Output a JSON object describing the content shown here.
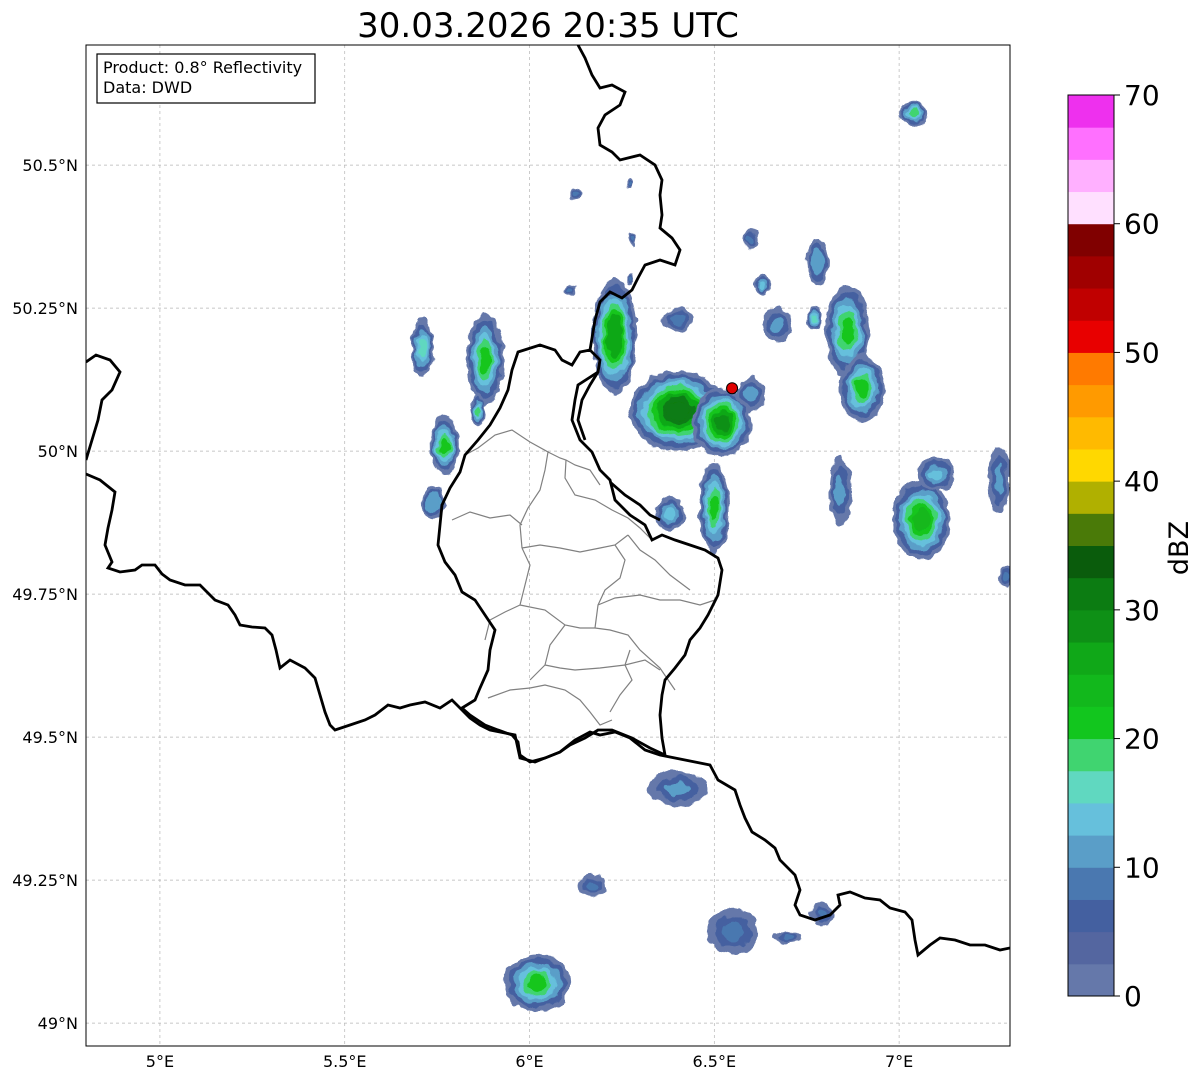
{
  "title": "30.03.2026 20:35 UTC",
  "info_box": {
    "product": "Product: 0.8° Reflectivity",
    "data_source": "Data: DWD"
  },
  "map": {
    "lon_range": [
      4.8,
      7.3
    ],
    "lat_range": [
      48.96,
      50.71
    ],
    "lon_ticks": [
      {
        "value": 5.0,
        "label": "5°E"
      },
      {
        "value": 5.5,
        "label": "5.5°E"
      },
      {
        "value": 6.0,
        "label": "6°E"
      },
      {
        "value": 6.5,
        "label": "6.5°E"
      },
      {
        "value": 7.0,
        "label": "7°E"
      }
    ],
    "lat_ticks": [
      {
        "value": 49.0,
        "label": "49°N"
      },
      {
        "value": 49.25,
        "label": "49.25°N"
      },
      {
        "value": 49.5,
        "label": "49.5°N"
      },
      {
        "value": 49.75,
        "label": "49.75°N"
      },
      {
        "value": 50.0,
        "label": "50°N"
      },
      {
        "value": 50.25,
        "label": "50.25°N"
      },
      {
        "value": 50.5,
        "label": "50.5°N"
      }
    ],
    "gridlines": true,
    "radar_site": {
      "lon": 6.548,
      "lat": 50.11,
      "color": "#e00000"
    }
  },
  "colorbar": {
    "label": "dBZ",
    "min": 0,
    "max": 70,
    "step": 2.5,
    "ticks": [
      0,
      10,
      20,
      30,
      40,
      50,
      60,
      70
    ],
    "colors": [
      "#6578aa",
      "#5466a0",
      "#4460a0",
      "#4a78b0",
      "#5a9ec8",
      "#66c0dc",
      "#60d8c0",
      "#40d470",
      "#12c61e",
      "#12b81c",
      "#10a818",
      "#0e9016",
      "#0c7c12",
      "#0a5c0c",
      "#4a7a08",
      "#b0b000",
      "#ffd800",
      "#ffba00",
      "#ff9a00",
      "#ff7a00",
      "#e80000",
      "#c00000",
      "#a00000",
      "#800000",
      "#ffe0ff",
      "#ffb0ff",
      "#ff70ff",
      "#ee30ee"
    ]
  },
  "echoes": [
    {
      "name": "cell-north-tiny-1",
      "lon": 7.04,
      "lat": 50.59,
      "rx": 0.04,
      "ry": 0.02,
      "dbz": 18
    },
    {
      "name": "cell-north-tiny-2",
      "lon": 6.12,
      "lat": 50.45,
      "rx": 0.015,
      "ry": 0.01,
      "dbz": 8
    },
    {
      "name": "cell-north-tiny-3",
      "lon": 6.27,
      "lat": 50.47,
      "rx": 0.01,
      "ry": 0.01,
      "dbz": 8
    },
    {
      "name": "cell-north-tiny-4",
      "lon": 6.28,
      "lat": 50.37,
      "rx": 0.01,
      "ry": 0.01,
      "dbz": 8
    },
    {
      "name": "cell-north-tiny-5",
      "lon": 6.6,
      "lat": 50.37,
      "rx": 0.02,
      "ry": 0.02,
      "dbz": 8
    },
    {
      "name": "cell-north-tiny-6",
      "lon": 6.11,
      "lat": 50.28,
      "rx": 0.015,
      "ry": 0.01,
      "dbz": 8
    },
    {
      "name": "cell-north-tiny-7",
      "lon": 6.27,
      "lat": 50.3,
      "rx": 0.01,
      "ry": 0.01,
      "dbz": 8
    },
    {
      "name": "cell-eifel-west-1",
      "lon": 5.71,
      "lat": 50.18,
      "rx": 0.03,
      "ry": 0.05,
      "dbz": 16
    },
    {
      "name": "cell-eifel-west-2",
      "lon": 5.88,
      "lat": 50.16,
      "rx": 0.05,
      "ry": 0.08,
      "dbz": 22
    },
    {
      "name": "cell-eifel-west-3",
      "lon": 5.77,
      "lat": 50.01,
      "rx": 0.04,
      "ry": 0.05,
      "dbz": 22
    },
    {
      "name": "cell-eifel-west-4",
      "lon": 5.74,
      "lat": 49.91,
      "rx": 0.03,
      "ry": 0.03,
      "dbz": 12
    },
    {
      "name": "cell-eifel-west-5",
      "lon": 5.86,
      "lat": 50.07,
      "rx": 0.02,
      "ry": 0.03,
      "dbz": 18
    },
    {
      "name": "cell-main-north",
      "lon": 6.23,
      "lat": 50.2,
      "rx": 0.06,
      "ry": 0.1,
      "dbz": 27
    },
    {
      "name": "cell-main-core",
      "lon": 6.4,
      "lat": 50.07,
      "rx": 0.13,
      "ry": 0.07,
      "dbz": 32
    },
    {
      "name": "cell-main-east",
      "lon": 6.52,
      "lat": 50.05,
      "rx": 0.08,
      "ry": 0.06,
      "dbz": 28
    },
    {
      "name": "cell-main-south",
      "lon": 6.5,
      "lat": 49.9,
      "rx": 0.04,
      "ry": 0.08,
      "dbz": 22
    },
    {
      "name": "cell-main-sw",
      "lon": 6.38,
      "lat": 49.89,
      "rx": 0.04,
      "ry": 0.03,
      "dbz": 14
    },
    {
      "name": "cell-main-ne-tail",
      "lon": 6.4,
      "lat": 50.23,
      "rx": 0.04,
      "ry": 0.02,
      "dbz": 9
    },
    {
      "name": "cell-east-1",
      "lon": 6.78,
      "lat": 50.33,
      "rx": 0.03,
      "ry": 0.04,
      "dbz": 12
    },
    {
      "name": "cell-east-2",
      "lon": 6.86,
      "lat": 50.21,
      "rx": 0.06,
      "ry": 0.08,
      "dbz": 20
    },
    {
      "name": "cell-east-3",
      "lon": 6.9,
      "lat": 50.11,
      "rx": 0.06,
      "ry": 0.06,
      "dbz": 20
    },
    {
      "name": "cell-east-4",
      "lon": 6.67,
      "lat": 50.22,
      "rx": 0.04,
      "ry": 0.03,
      "dbz": 10
    },
    {
      "name": "cell-east-5",
      "lon": 6.77,
      "lat": 50.23,
      "rx": 0.02,
      "ry": 0.02,
      "dbz": 16
    },
    {
      "name": "cell-east-6",
      "lon": 6.63,
      "lat": 50.29,
      "rx": 0.02,
      "ry": 0.02,
      "dbz": 14
    },
    {
      "name": "cell-east-7",
      "lon": 6.6,
      "lat": 50.1,
      "rx": 0.04,
      "ry": 0.03,
      "dbz": 10
    },
    {
      "name": "cell-se-1",
      "lon": 6.84,
      "lat": 49.93,
      "rx": 0.03,
      "ry": 0.06,
      "dbz": 10
    },
    {
      "name": "cell-se-2",
      "lon": 7.06,
      "lat": 49.88,
      "rx": 0.08,
      "ry": 0.07,
      "dbz": 24
    },
    {
      "name": "cell-se-3",
      "lon": 7.1,
      "lat": 49.96,
      "rx": 0.05,
      "ry": 0.03,
      "dbz": 14
    },
    {
      "name": "cell-far-east-1",
      "lon": 7.27,
      "lat": 49.95,
      "rx": 0.03,
      "ry": 0.06,
      "dbz": 10
    },
    {
      "name": "cell-far-east-2",
      "lon": 7.29,
      "lat": 49.78,
      "rx": 0.02,
      "ry": 0.02,
      "dbz": 8
    },
    {
      "name": "cell-saar-1",
      "lon": 6.4,
      "lat": 49.41,
      "rx": 0.08,
      "ry": 0.03,
      "dbz": 10
    },
    {
      "name": "cell-saar-2",
      "lon": 6.17,
      "lat": 49.24,
      "rx": 0.04,
      "ry": 0.02,
      "dbz": 8
    },
    {
      "name": "cell-saar-3",
      "lon": 6.55,
      "lat": 49.16,
      "rx": 0.07,
      "ry": 0.04,
      "dbz": 9
    },
    {
      "name": "cell-saar-4",
      "lon": 6.7,
      "lat": 49.15,
      "rx": 0.04,
      "ry": 0.01,
      "dbz": 8
    },
    {
      "name": "cell-saar-5",
      "lon": 6.79,
      "lat": 49.19,
      "rx": 0.03,
      "ry": 0.02,
      "dbz": 8
    },
    {
      "name": "cell-lorraine",
      "lon": 6.02,
      "lat": 49.07,
      "rx": 0.09,
      "ry": 0.05,
      "dbz": 22
    }
  ]
}
